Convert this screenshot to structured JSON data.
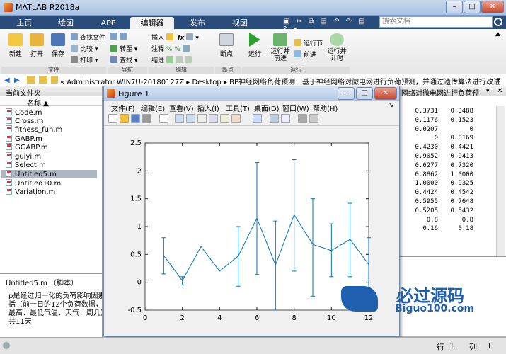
{
  "app": {
    "title": "MATLAB R2018a"
  },
  "tabs": [
    {
      "label": "主页"
    },
    {
      "label": "绘图"
    },
    {
      "label": "APP"
    },
    {
      "label": "编辑器"
    },
    {
      "label": "发布"
    },
    {
      "label": "视图"
    }
  ],
  "search": {
    "placeholder": "搜索文档"
  },
  "ribbon": {
    "file_group": {
      "label": "文件",
      "new": "新建",
      "open": "打开",
      "save": "保存",
      "find_files": "查找文件",
      "compare": "比较",
      "print": "打印"
    },
    "nav_group": {
      "label": "导航",
      "goto": "转至",
      "find": "查找"
    },
    "edit_group": {
      "label": "编辑",
      "insert": "插入",
      "comment": "注释",
      "indent": "缩进"
    },
    "breakpoint_group": {
      "label": "断点",
      "breakpoints": "断点"
    },
    "run_group": {
      "label": "运行",
      "run": "运行",
      "run_advance": "运行并\n前进",
      "run_section": "运行节",
      "advance": "前进",
      "run_time": "运行并\n计时"
    }
  },
  "address": {
    "segments": [
      "« Administrator.WIN7U-20180127Z",
      "Desktop",
      "BP神经网络负荷预测：基于神经网络对微电网进行负荷预测，并通过遗传算法进行改进"
    ]
  },
  "current_folder": {
    "title": "当前文件夹",
    "col_header": "名称",
    "files": [
      "Code.m",
      "Cross.m",
      "fitness_fun.m",
      "GABP.m",
      "GGABP.m",
      "guiyi.m",
      "Select.m",
      "Untitled5.m",
      "Untitled10.m",
      "Variation.m"
    ],
    "selected_index": 7
  },
  "details": {
    "title": "Untitled5.m （脚本）",
    "text": "p是经过归一化的负荷影响因素，每\n括（前一日的12个负荷数据，本日\n最高、最低气温、天气、周几），\n共11天"
  },
  "figure": {
    "title": "Figure 1",
    "menu": [
      "文件(F)",
      "编辑(E)",
      "查看(V)",
      "插入(I)",
      "工具(T)",
      "桌面(D)",
      "窗口(W)",
      "帮助(H)"
    ]
  },
  "right_path": "网络对微电网进行负荷预",
  "matrix": {
    "rows": [
      [
        "0.3731",
        "0.3488"
      ],
      [
        "0.1176",
        "0.1523"
      ],
      [
        "0.0207",
        "0"
      ],
      [
        "0",
        "0.0169"
      ],
      [
        "0.4230",
        "0.4421"
      ],
      [
        "0.9052",
        "0.9413"
      ],
      [
        "0.6277",
        "0.7320"
      ],
      [
        "0.8862",
        "1.0000"
      ],
      [
        "1.0000",
        "0.9325"
      ],
      [
        "0.4424",
        "0.4542"
      ],
      [
        "0.5955",
        "0.7648"
      ],
      [
        "0.5205",
        "0.5432"
      ],
      [
        "0.8",
        "0.8"
      ],
      [
        "0.16",
        "0.18"
      ]
    ]
  },
  "status": {
    "line_label": "行",
    "line_value": "1",
    "col_label": "列",
    "col_value": "1"
  },
  "watermark": {
    "title": "必过源码",
    "url": "Biguo100.com"
  },
  "colors": {
    "accent": "#2a4c7a",
    "plot_line": "#0072bd",
    "selected": "#aeb6c1"
  },
  "chart_data": {
    "type": "line",
    "x": [
      1,
      2,
      3,
      4,
      5,
      6,
      7,
      8,
      9,
      10,
      11,
      12
    ],
    "y": [
      0.48,
      0.03,
      0.64,
      0.2,
      0.47,
      1.15,
      0.31,
      1.21,
      0.68,
      0.57,
      0.77,
      0.32
    ],
    "err_low": [
      0.15,
      -0.05,
      0.64,
      0.2,
      -0.07,
      0.14,
      -0.5,
      0.2,
      -0.25,
      0.1,
      0.1,
      -0.5
    ],
    "err_high": [
      0.8,
      0.1,
      0.64,
      0.2,
      1.0,
      2.15,
      1.1,
      2.2,
      1.5,
      1.05,
      1.42,
      0.8
    ],
    "xlim": [
      0,
      12
    ],
    "ylim": [
      -0.5,
      2.5
    ],
    "xticks": [
      0,
      2,
      4,
      6,
      8,
      10,
      12
    ],
    "yticks": [
      -0.5,
      0,
      0.5,
      1,
      1.5,
      2,
      2.5
    ],
    "ytick_labels": [
      "-0.5",
      "0",
      "0.5",
      "1",
      "1.5",
      "2",
      "2.5"
    ],
    "grid": false
  }
}
